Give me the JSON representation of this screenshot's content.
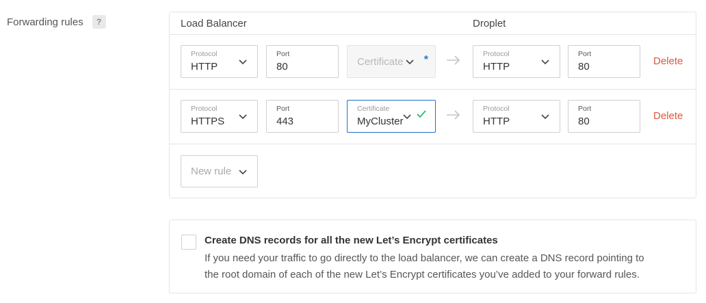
{
  "section": {
    "label": "Forwarding rules",
    "help": "?"
  },
  "table": {
    "load_balancer_heading": "Load Balancer",
    "droplet_heading": "Droplet"
  },
  "rules": [
    {
      "lb_protocol_label": "Protocol",
      "lb_protocol_value": "HTTP",
      "lb_port_label": "Port",
      "lb_port_value": "80",
      "certificate_placeholder": "Certificate",
      "certificate_required_mark": "*",
      "droplet_protocol_label": "Protocol",
      "droplet_protocol_value": "HTTP",
      "droplet_port_label": "Port",
      "droplet_port_value": "80",
      "delete_label": "Delete"
    },
    {
      "lb_protocol_label": "Protocol",
      "lb_protocol_value": "HTTPS",
      "lb_port_label": "Port",
      "lb_port_value": "443",
      "certificate_label": "Certificate",
      "certificate_value": "MyCluster",
      "droplet_protocol_label": "Protocol",
      "droplet_protocol_value": "HTTP",
      "droplet_port_label": "Port",
      "droplet_port_value": "80",
      "delete_label": "Delete"
    }
  ],
  "new_rule": {
    "placeholder": "New rule"
  },
  "dns": {
    "checked": false,
    "title": "Create DNS records for all the new Let’s Encrypt certificates",
    "description_line1": "If you need your traffic to go directly to the load balancer, we can create a DNS record pointing to",
    "description_line2": "the root domain of each of the new Let’s Encrypt certificates you’ve added to your forward rules."
  },
  "colors": {
    "delete": "#e0553f",
    "focus_border": "#1c6fc7",
    "check": "#2bb673",
    "asterisk": "#1a7ad9"
  },
  "icons": {
    "dropdown": "chevron-down-icon",
    "arrow": "arrow-right-icon",
    "valid": "check-icon"
  }
}
